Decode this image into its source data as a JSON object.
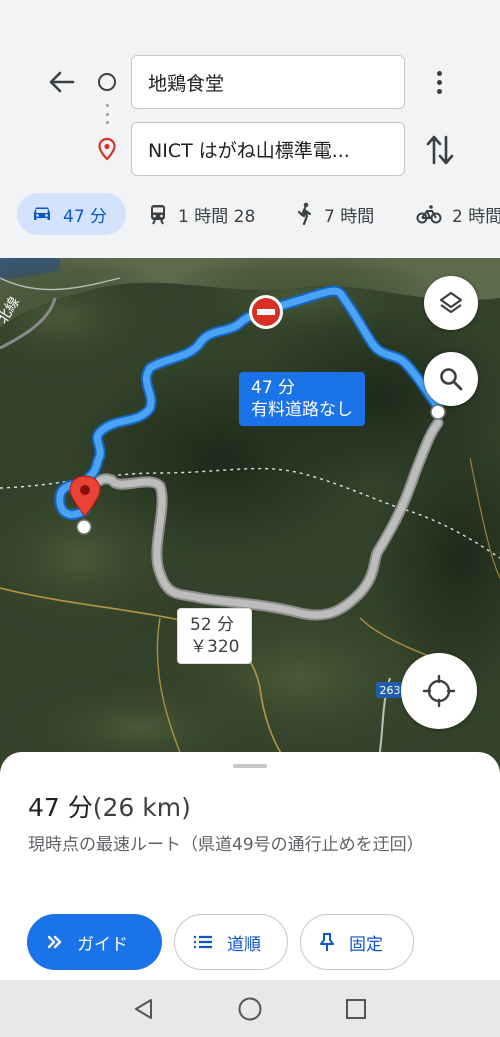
{
  "search": {
    "origin_value": "地鶏食堂",
    "destination_value": "NICT はがね山標準電..."
  },
  "travel_modes": [
    {
      "mode": "drive",
      "icon": "car-icon",
      "label": "47 分",
      "selected": true
    },
    {
      "mode": "transit",
      "icon": "train-icon",
      "label": "1 時間 28",
      "selected": false
    },
    {
      "mode": "walk",
      "icon": "walk-icon",
      "label": "7 時間",
      "selected": false
    },
    {
      "mode": "bike",
      "icon": "bicycle-icon",
      "label": "2 時間",
      "selected": false
    }
  ],
  "map": {
    "route_callout": {
      "time": "47 分",
      "note": "有料道路なし"
    },
    "alt_callout": {
      "time": "52 分",
      "toll": "￥320"
    },
    "road_shield": "263",
    "rail_label": "北線"
  },
  "sheet": {
    "duration": "47 分",
    "distance": "(26 km)",
    "description": "現時点の最速ルート（県道49号の通行止めを迂回）",
    "buttons": {
      "guide": "ガイド",
      "steps": "道順",
      "pin": "固定"
    }
  },
  "colors": {
    "primary_blue": "#1a73e8",
    "selected_chip": "#d3e3fd",
    "route_main": "#4aa3f5",
    "route_alt": "#b4b4b4",
    "closure_red": "#d93025"
  }
}
